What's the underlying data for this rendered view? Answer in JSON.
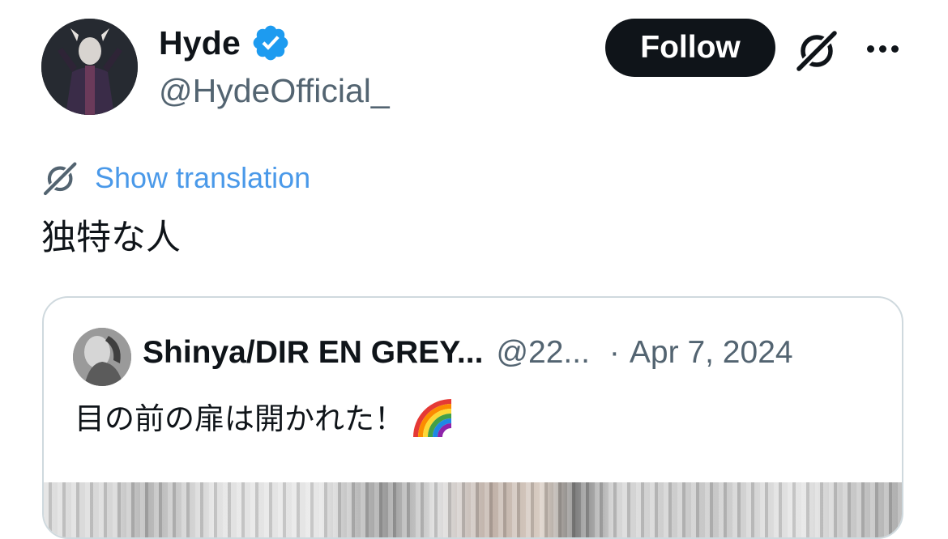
{
  "author": {
    "display_name": "Hyde",
    "handle": "@HydeOfficial_"
  },
  "actions": {
    "follow_label": "Follow",
    "grok_icon": "grok-icon",
    "more_icon": "more-options-icon"
  },
  "translation": {
    "link_label": "Show translation"
  },
  "tweet": {
    "text": "独特な人"
  },
  "quote": {
    "display_name": "Shinya/DIR EN GREY...",
    "handle": "@22...",
    "separator": "·",
    "date": "Apr 7, 2024",
    "text": "目の前の扉は開かれた！"
  },
  "colors": {
    "text_primary": "#0f1419",
    "text_secondary": "#536471",
    "link": "#4a99e9",
    "verified": "#1d9bf0",
    "border": "#cfd9de"
  }
}
